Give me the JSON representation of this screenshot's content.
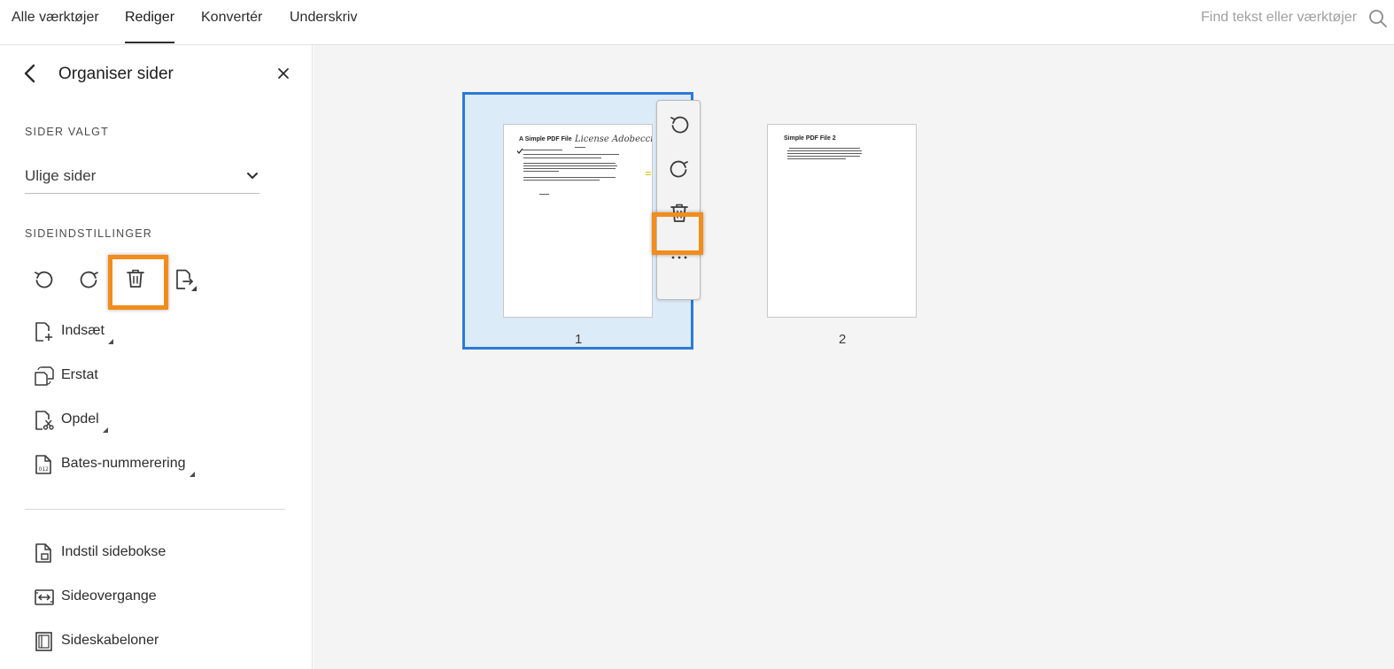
{
  "topbar": {
    "tabs": [
      "Alle værktøjer",
      "Rediger",
      "Konvertér",
      "Underskriv"
    ],
    "active_tab": "Rediger",
    "search_placeholder": "Find tekst eller værktøjer",
    "search_icon": "search-icon"
  },
  "panel": {
    "title": "Organiser sider",
    "back_icon": "chevron-left-icon",
    "close_icon": "close-icon",
    "pages_selected_label": "SIDER VALGT",
    "pages_selected_value": "Ulige sider",
    "page_settings_label": "SIDEINDSTILLINGER",
    "tools": [
      "rotate-left-icon",
      "rotate-right-icon",
      "trash-icon",
      "extract-pages-icon"
    ],
    "menu": [
      {
        "label": "Indsæt",
        "icon": "insert-page-icon",
        "has_submenu": true
      },
      {
        "label": "Erstat",
        "icon": "replace-page-icon",
        "has_submenu": false
      },
      {
        "label": "Opdel",
        "icon": "split-page-icon",
        "has_submenu": true
      },
      {
        "label": "Bates-nummerering",
        "icon": "bates-numbering-icon",
        "has_submenu": true
      }
    ],
    "menu2": [
      {
        "label": "Indstil sidebokse",
        "icon": "page-box-icon"
      },
      {
        "label": "Sideovergange",
        "icon": "page-transition-icon"
      },
      {
        "label": "Sideskabeloner",
        "icon": "page-template-icon"
      }
    ]
  },
  "pages": [
    {
      "number": "1",
      "title": "A Simple PDF File",
      "signature": "License Adobecci",
      "selected": true
    },
    {
      "number": "2",
      "title": "Simple PDF File 2",
      "selected": false
    }
  ],
  "page_toolbar": [
    "rotate-left-icon",
    "rotate-right-icon",
    "trash-icon",
    "more-icon"
  ],
  "colors": {
    "highlight": "#f28c1b",
    "selection_border": "#2d7ad6",
    "selection_fill": "#dcebf8"
  }
}
